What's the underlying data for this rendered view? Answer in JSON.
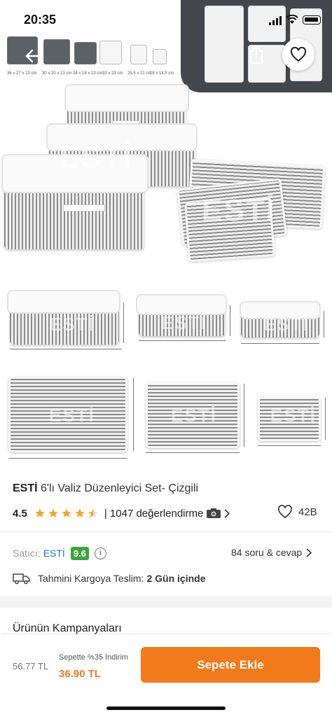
{
  "status_bar": {
    "time": "20:35"
  },
  "hero": {
    "watermark": "ESTİ",
    "size_labels": [
      "36 x 27 x 13 cm",
      "30 x 20 x 13 cm",
      "24 x 18 x 13 cm",
      "33 x 23 cm",
      "25,5 x 21 cm",
      "18 x 14,5 cm"
    ]
  },
  "product": {
    "brand": "ESTİ",
    "name": "6'lı Valiz Düzenleyici Set- Çizgili",
    "rating": "4.5",
    "rating_fraction": 0.9,
    "review_count": "| 1047 değerlendirme",
    "likes": "42B"
  },
  "seller": {
    "label": "Satıcı:",
    "name": "ESTİ",
    "score": "9.6",
    "qa_link": "84 soru & cevap"
  },
  "shipping": {
    "label": "Tahmini Kargoya Teslim:",
    "value": "2 Gün içinde"
  },
  "campaigns": {
    "title": "Ürünün Kampanyaları"
  },
  "bottom_bar": {
    "old_price": "56.77 TL",
    "cart_discount": "Sepette %35 İndirim",
    "new_price": "36.90 TL",
    "add_to_cart": "Sepete Ekle"
  },
  "colors": {
    "accent": "#f27a1a",
    "seller_badge": "#3ca53c",
    "link": "#1a73e8",
    "star": "#f5a623"
  },
  "icons": [
    "back-arrow-icon",
    "share-icon",
    "heart-icon",
    "star-icon",
    "camera-icon",
    "chevron-right-icon",
    "info-icon",
    "truck-icon"
  ]
}
